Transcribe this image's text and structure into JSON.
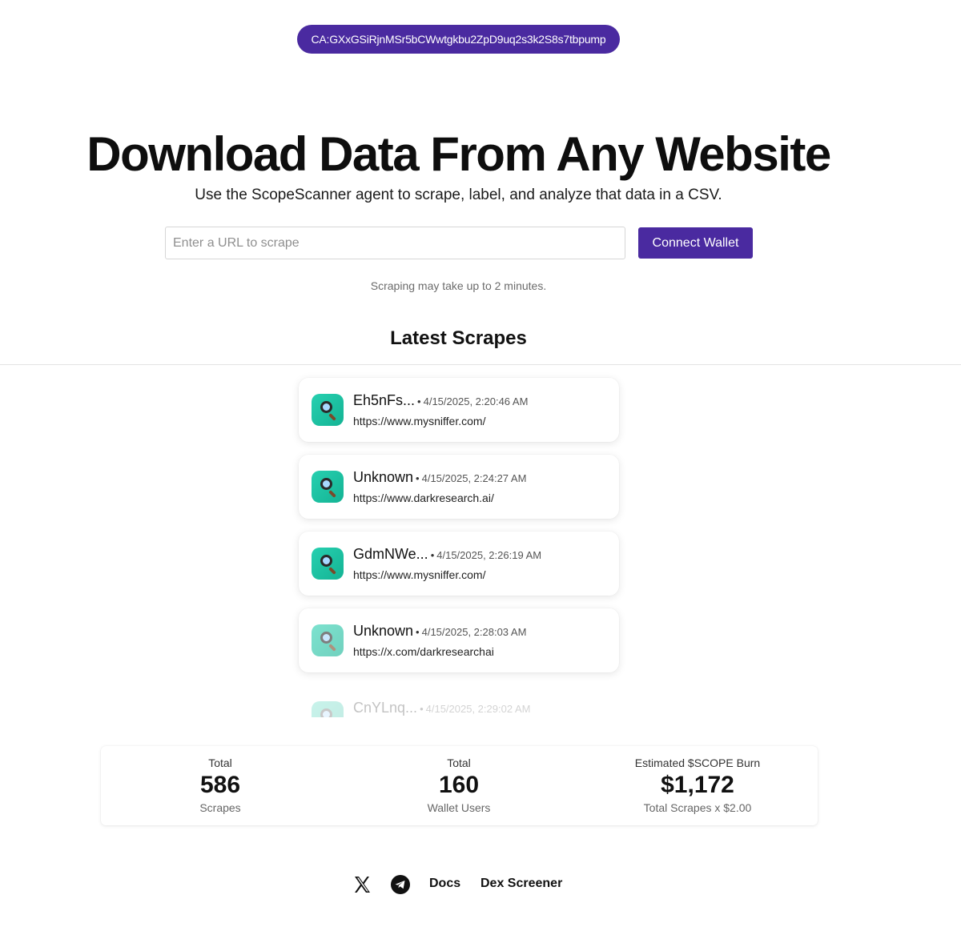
{
  "contract": {
    "label": "CA:GXxGSiRjnMSr5bCWwtgkbu2ZpD9uq2s3k2S8s7tbpump"
  },
  "hero": {
    "title": "Download Data From Any Website",
    "subtitle": "Use the ScopeScanner agent to scrape, label, and analyze that data in a CSV."
  },
  "form": {
    "url_placeholder": "Enter a URL to scrape",
    "url_value": "",
    "connect_label": "Connect Wallet",
    "notice": "Scraping may take up to 2 minutes."
  },
  "latest": {
    "title": "Latest Scrapes",
    "items": [
      {
        "name": "Eh5nFs...",
        "time": "4/15/2025, 2:20:46 AM",
        "url": "https://www.mysniffer.com/",
        "icon": "magnifier-icon"
      },
      {
        "name": "Unknown",
        "time": "4/15/2025, 2:24:27 AM",
        "url": "https://www.darkresearch.ai/",
        "icon": "magnifier-icon"
      },
      {
        "name": "GdmNWe...",
        "time": "4/15/2025, 2:26:19 AM",
        "url": "https://www.mysniffer.com/",
        "icon": "magnifier-icon"
      },
      {
        "name": "Unknown",
        "time": "4/15/2025, 2:28:03 AM",
        "url": "https://x.com/darkresearchai",
        "icon": "magnifier-icon"
      },
      {
        "name": "CnYLnq...",
        "time": "4/15/2025, 2:29:02 AM",
        "url": "",
        "icon": "magnifier-icon"
      }
    ]
  },
  "stats": [
    {
      "label": "Total",
      "value": "586",
      "sub": "Scrapes"
    },
    {
      "label": "Total",
      "value": "160",
      "sub": "Wallet Users"
    },
    {
      "label": "Estimated $SCOPE Burn",
      "value": "$1,172",
      "sub": "Total Scrapes x $2.00"
    }
  ],
  "footer": {
    "x_icon": "x-logo-icon",
    "telegram_icon": "telegram-icon",
    "docs_label": "Docs",
    "dex_label": "Dex Screener"
  },
  "colors": {
    "accent": "#4a2aa0",
    "icon_teal": "#1cc3a3"
  }
}
